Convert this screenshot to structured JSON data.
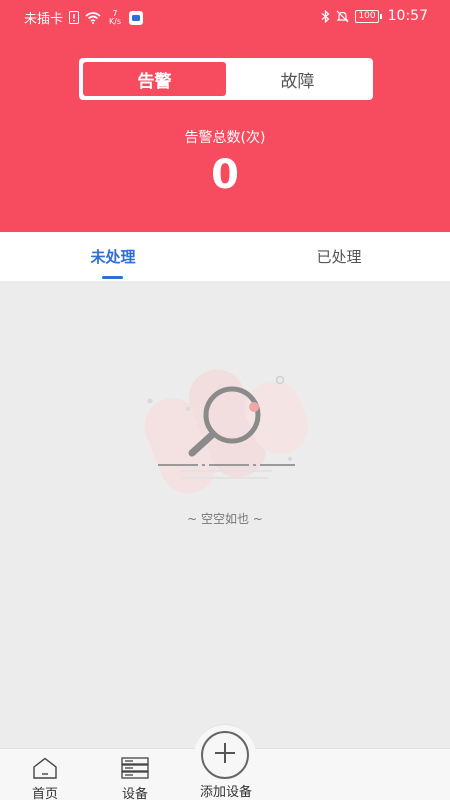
{
  "status_bar": {
    "carrier": "未插卡",
    "net_speed_value": "7",
    "net_speed_unit": "K/s",
    "battery": "100",
    "time": "10:57"
  },
  "header": {
    "segments": [
      {
        "label": "告警",
        "active": true
      },
      {
        "label": "故障",
        "active": false
      }
    ],
    "total_label": "告警总数(次)",
    "total_value": "0"
  },
  "tabs": [
    {
      "label": "未处理",
      "active": true
    },
    {
      "label": "已处理",
      "active": false
    }
  ],
  "empty_state": {
    "text": "~ 空空如也 ~",
    "icon": "magnifier-icon"
  },
  "bottom_nav": {
    "items": [
      {
        "label": "首页",
        "icon": "home-icon"
      },
      {
        "label": "设备",
        "icon": "server-icon"
      },
      {
        "label": "添加设备",
        "icon": "plus-icon"
      }
    ]
  },
  "colors": {
    "header_bg": "#f74b5f",
    "active_tab": "#2f6ed6",
    "page_bg": "#ececec"
  }
}
